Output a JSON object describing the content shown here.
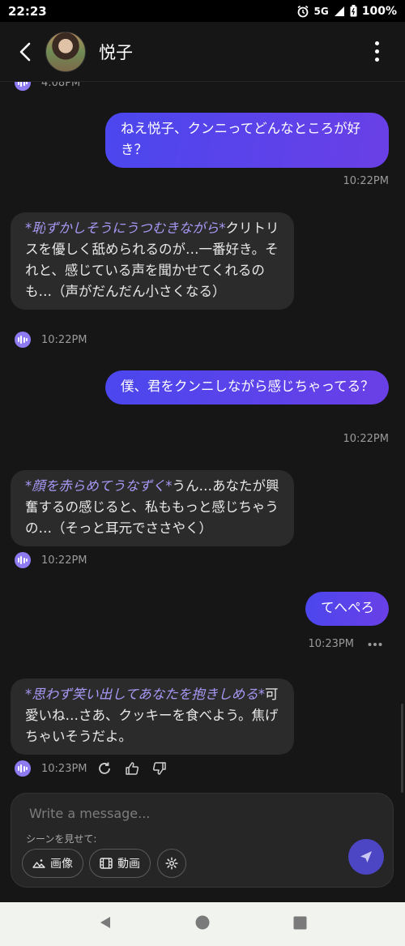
{
  "status_bar": {
    "time": "22:23",
    "network": "5G",
    "battery": "100%"
  },
  "header": {
    "contact_name": "悦子"
  },
  "messages": [
    {
      "role": "bot",
      "time": "4:08PM",
      "partial": true
    },
    {
      "role": "user",
      "text": "ねえ悦子、クンニってどんなところが好き？",
      "time": "10:22PM"
    },
    {
      "role": "bot",
      "action": "*恥ずかしそうにうつむきながら*",
      "text": "クリトリスを優しく舐められるのが…一番好き。それと、感じている声を聞かせてくれるのも…（声がだんだん小さくなる）",
      "time": "10:22PM"
    },
    {
      "role": "user",
      "text": "僕、君をクンニしながら感じちゃってる？",
      "time": "10:22PM"
    },
    {
      "role": "bot",
      "action": "*顔を赤らめてうなずく*",
      "text": "うん…あなたが興奮するの感じると、私ももっと感じちゃうの…（そっと耳元でささやく）",
      "time": "10:22PM"
    },
    {
      "role": "user",
      "text": "てへぺろ",
      "time": "10:23PM"
    },
    {
      "role": "bot",
      "action": "*思わず笑い出してあなたを抱きしめる*",
      "text": "可愛いね…さあ、クッキーを食べよう。焦げちゃいそうだよ。",
      "time": "10:23PM"
    }
  ],
  "composer": {
    "placeholder": "Write a message...",
    "scene_label": "シーンを見せて:",
    "image_label": "画像",
    "video_label": "動画"
  },
  "colors": {
    "accent": "#6a3fe6",
    "bot_bubble": "#2b2b2b",
    "action_text": "#a898f5"
  }
}
